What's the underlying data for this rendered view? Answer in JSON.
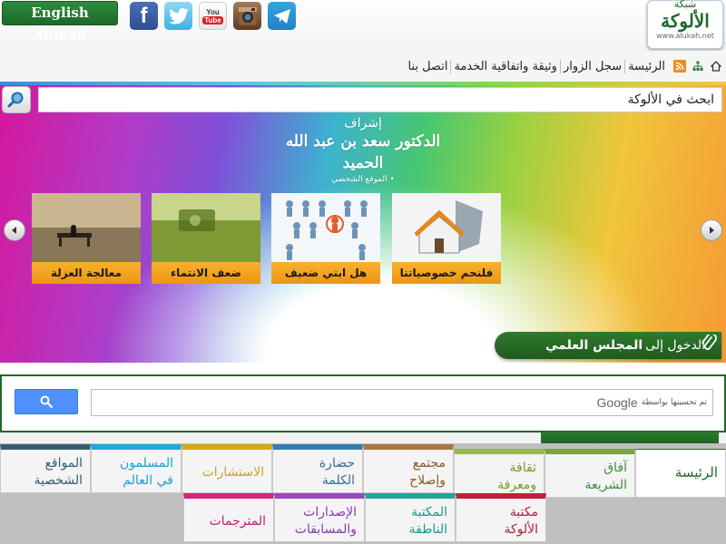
{
  "header": {
    "english_button": "English Alukah",
    "social": [
      {
        "name": "facebook",
        "glyph": "f"
      },
      {
        "name": "twitter",
        "glyph": "t"
      },
      {
        "name": "youtube",
        "glyph_top": "You",
        "glyph_bottom": "Tube"
      },
      {
        "name": "instagram"
      },
      {
        "name": "telegram"
      }
    ],
    "logo": {
      "top": "شبكة",
      "main": "الألوكة",
      "url": "www.alukah.net"
    }
  },
  "nav": {
    "links": [
      "الرئيسة",
      "سجل الزوار",
      "وثيقة واتفاقية الخدمة",
      "اتصل بنا"
    ]
  },
  "search": {
    "placeholder": "ابحث في الألوكة"
  },
  "banner": {
    "supervision_line1": "إشراف",
    "supervision_line2": "الدكتور سعد بن عبد الله الحميد",
    "supervision_line3": "• الموقع الشخصي",
    "thumbs": [
      {
        "caption": "فلنحم خصوصياتنا"
      },
      {
        "caption": "هل ابني ضعيف"
      },
      {
        "caption": "ضعف الانتماء"
      },
      {
        "caption": "معالجة العزلة"
      }
    ],
    "council_prefix": "الدخول إلى",
    "council_bold": "المجلس العلمي"
  },
  "gcse": {
    "enhanced_by": "تم تحسينها بواسطة",
    "google": "Google"
  },
  "tabs": [
    {
      "label_1": "الرئيسة",
      "label_2": "",
      "color": "#1b6a29",
      "border": "#1b6a29"
    },
    {
      "label_1": "آفاق",
      "label_2": "الشريعة",
      "color": "#3a8f3a",
      "border": "#7aa52f"
    },
    {
      "label_1": "ثقافة",
      "label_2": "ومعرفة",
      "color": "#7a9a2a",
      "border": "#9cb840"
    },
    {
      "label_1": "مجتمع",
      "label_2": "وإصلاح",
      "color": "#8a5a24",
      "border": "#a9773f"
    },
    {
      "label_1": "حضارة",
      "label_2": "الكلمة",
      "color": "#2f6f9a",
      "border": "#2f7fb0"
    },
    {
      "label_1": "الاستشارات",
      "label_2": "",
      "color": "#c9a227",
      "border": "#d4a817"
    },
    {
      "label_1": "المسلمون",
      "label_2": "في العالم",
      "color": "#1aa0d8",
      "border": "#20a8e0"
    },
    {
      "label_1": "المواقع",
      "label_2": "الشخصية",
      "color": "#2f5f6f",
      "border": "#355f6a"
    },
    {
      "label_1": "مكتبة",
      "label_2": "الألوكة",
      "color": "#b0203a",
      "border": "#c0203c"
    },
    {
      "label_1": "المكتبة",
      "label_2": "الناطقة",
      "color": "#1a9a8a",
      "border": "#20a79a"
    },
    {
      "label_1": "الإصدارات",
      "label_2": "والمسابقات",
      "color": "#8e3ab0",
      "border": "#9a48c0"
    },
    {
      "label_1": "المترجمات",
      "label_2": "",
      "color": "#c0206a",
      "border": "#d02878"
    }
  ]
}
